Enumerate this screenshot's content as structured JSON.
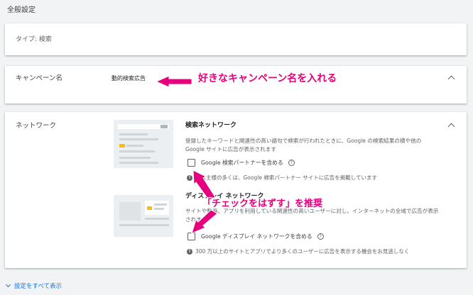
{
  "header": {
    "title": "全般設定"
  },
  "type_card": {
    "text": "タイプ: 検索"
  },
  "campaign_card": {
    "label": "キャンペーン名",
    "value": "動的検索広告"
  },
  "network_card": {
    "label": "ネットワーク",
    "search": {
      "title": "検索ネットワーク",
      "description": "登録したキーワードと関連性の高い語句で検索が行われたときに、Google の検索結果の横や他の Google サイトに広告が表示されます",
      "checkbox_label": "Google 検索パートナーを含める",
      "info": "広告主様の多くは、Google 検索パートナー サイトに広告を掲載しています"
    },
    "display": {
      "title": "ディスプレイ ネットワーク",
      "description": "サイトや動画、アプリを利用している関連性の高いユーザーに対し、インターネットの全域で広告が表示されます",
      "checkbox_label": "Google ディスプレイ ネットワークを含める",
      "info": "300 万以上のサイトとアプリでより多くのユーザーに広告を表示する機会をお見逃しなく"
    }
  },
  "footer": {
    "show_all": "設定をすべて表示"
  },
  "annotations": {
    "campaign_hint": "好きなキャンペーン名を入れる",
    "uncheck_hint": "「チェックをはずす」を推奨"
  },
  "colors": {
    "accent": "#1a73e8",
    "annotation": "#e6007e",
    "thumb_highlight": "#fbbc04"
  }
}
